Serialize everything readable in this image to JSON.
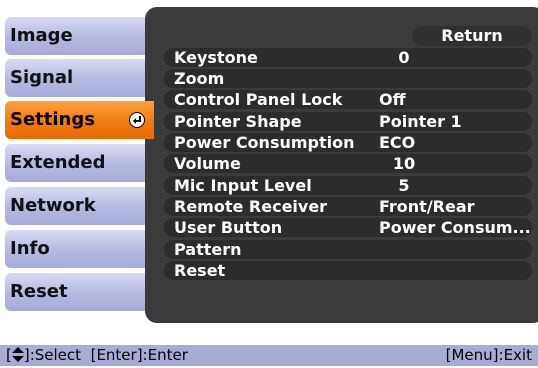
{
  "tabs": [
    {
      "label": "Image"
    },
    {
      "label": "Signal"
    },
    {
      "label": "Settings",
      "selected": true
    },
    {
      "label": "Extended"
    },
    {
      "label": "Network"
    },
    {
      "label": "Info"
    },
    {
      "label": "Reset"
    }
  ],
  "panel": {
    "return_label": "Return",
    "rows": [
      {
        "label": "Keystone",
        "value": "0"
      },
      {
        "label": "Zoom",
        "value": ""
      },
      {
        "label": "Control Panel Lock",
        "value": "Off"
      },
      {
        "label": "Pointer Shape",
        "value": "Pointer 1"
      },
      {
        "label": "Power Consumption",
        "value": "ECO"
      },
      {
        "label": "Volume",
        "value": "10"
      },
      {
        "label": "Mic Input Level",
        "value": "5"
      },
      {
        "label": "Remote Receiver",
        "value": "Front/Rear"
      },
      {
        "label": "User Button",
        "value": "Power Consum..."
      },
      {
        "label": "Pattern",
        "value": ""
      },
      {
        "label": "Reset",
        "value": ""
      }
    ]
  },
  "help": {
    "select_prefix": "[",
    "select_suffix": "]:Select",
    "enter": "[Enter]:Enter",
    "exit": "[Menu]:Exit"
  },
  "colors": {
    "tab": "#b4b9e0",
    "tab_selected": "#f07b12",
    "panel": "#3b3b3b",
    "row": "#2c2c2c",
    "helpbar": "#a9acd2"
  }
}
